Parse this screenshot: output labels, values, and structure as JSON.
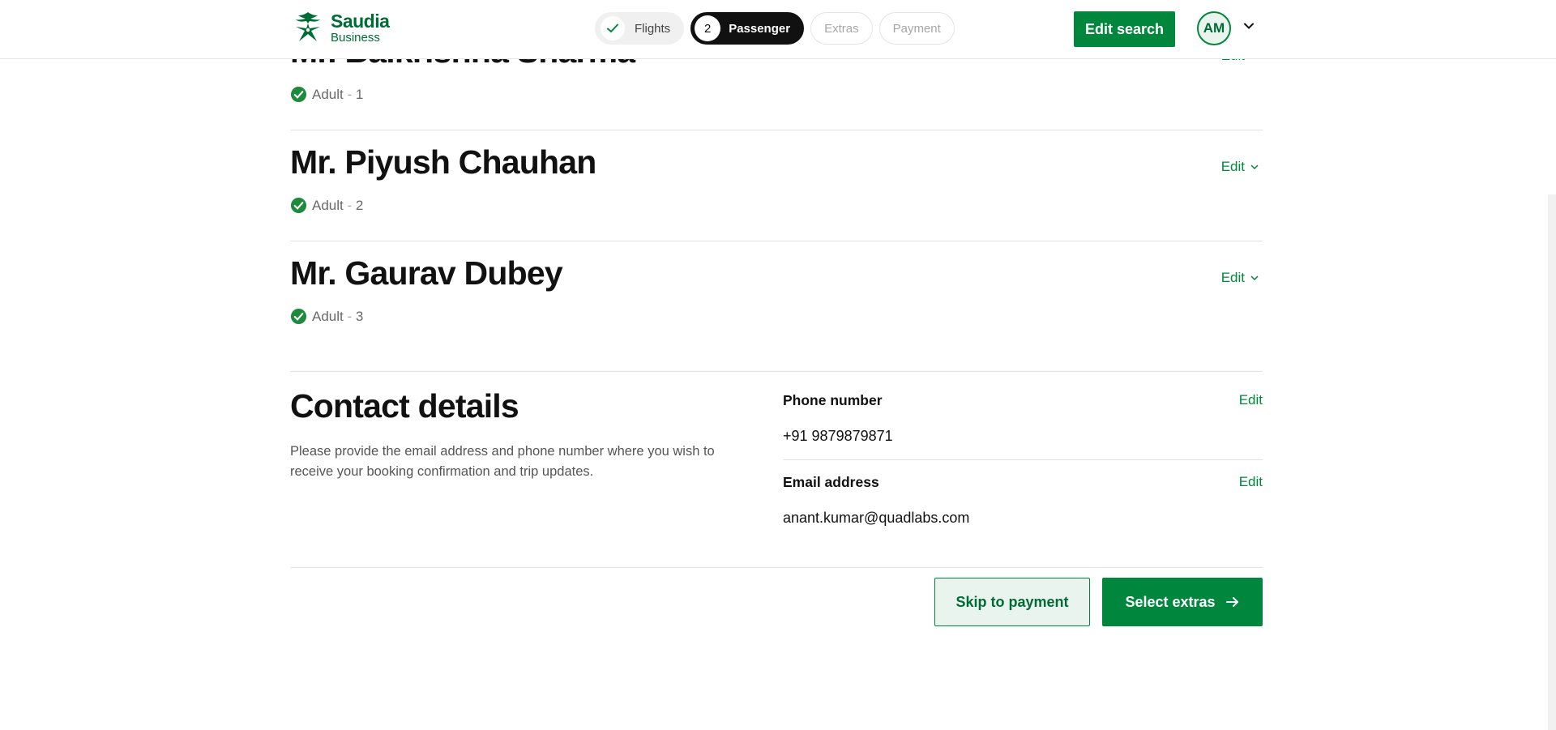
{
  "header": {
    "logo": {
      "line1": "Saudia",
      "line2": "Business"
    },
    "steps": [
      {
        "label": "Flights",
        "status": "done"
      },
      {
        "number": "2",
        "label": "Passenger",
        "status": "active"
      },
      {
        "label": "Extras",
        "status": "pending"
      },
      {
        "label": "Payment",
        "status": "pending"
      }
    ],
    "edit_search": "Edit search",
    "avatar": "AM"
  },
  "passengers": [
    {
      "name": "Mr. Balkrishna Sharma",
      "type": "Adult",
      "sep": "-",
      "index": "1",
      "edit": "Edit"
    },
    {
      "name": "Mr. Piyush Chauhan",
      "type": "Adult",
      "sep": "-",
      "index": "2",
      "edit": "Edit"
    },
    {
      "name": "Mr. Gaurav Dubey",
      "type": "Adult",
      "sep": "-",
      "index": "3",
      "edit": "Edit"
    }
  ],
  "contact": {
    "title": "Contact details",
    "description": "Please provide the email address and phone number where you wish to receive your booking confirmation and trip updates.",
    "phone_label": "Phone number",
    "phone_value": "+91 9879879871",
    "email_label": "Email address",
    "email_value": "anant.kumar@quadlabs.com",
    "edit": "Edit"
  },
  "actions": {
    "skip": "Skip to payment",
    "extras": "Select extras"
  },
  "colors": {
    "brand_green": "#00873d",
    "brand_dark_green": "#006c35",
    "check_green": "#1e8a3c"
  }
}
